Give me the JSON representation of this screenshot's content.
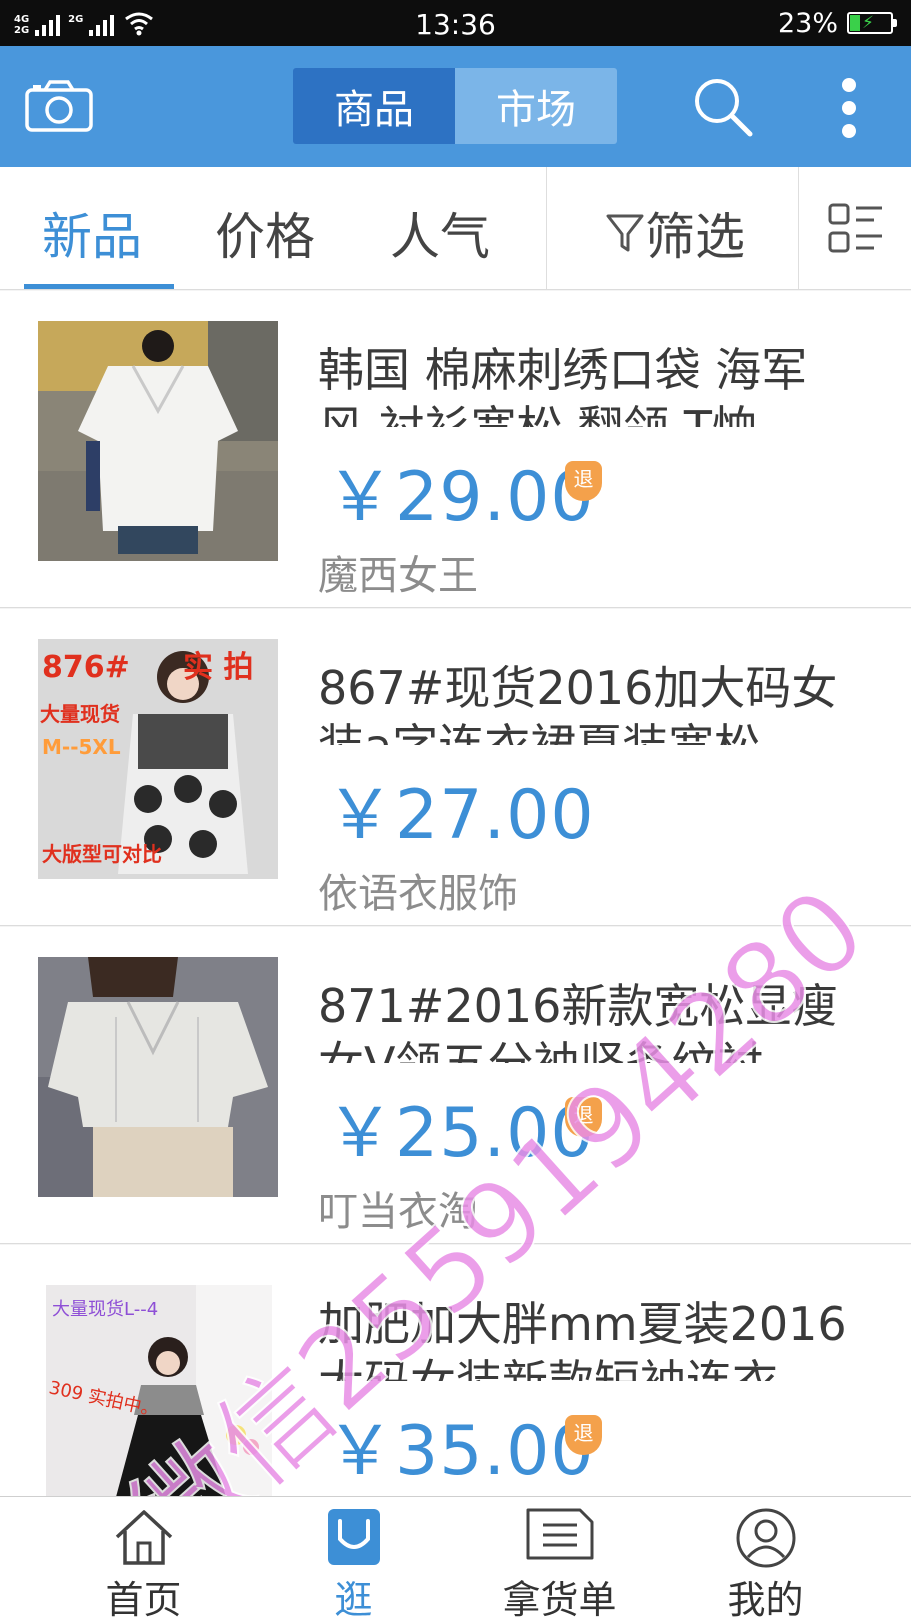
{
  "status_bar": {
    "network_top": "4G",
    "network_bottom": "2G",
    "network2": "2G",
    "time": "13:36",
    "battery": "23%"
  },
  "header": {
    "tabs": [
      {
        "label": "商品",
        "active": true
      },
      {
        "label": "市场",
        "active": false
      }
    ],
    "icons": [
      "camera-icon",
      "search-icon",
      "more-icon"
    ]
  },
  "sort_bar": {
    "tabs": [
      {
        "label": "新品",
        "active": true
      },
      {
        "label": "价格",
        "active": false
      },
      {
        "label": "人气",
        "active": false
      }
    ],
    "filter_label": "筛选"
  },
  "products": [
    {
      "title_line1": "韩国 棉麻刺绣口袋 海军",
      "title_line2": "风 衬衫宽松 翻领 T恤 …",
      "price": "￥29.00",
      "badge": "退",
      "shop": "魔西女王"
    },
    {
      "title_line1": "867#现货2016加大码女",
      "title_line2": "装a字连衣裙夏装宽松…",
      "price": "￥27.00",
      "badge": "",
      "shop": "依语衣服饰",
      "photo_text": {
        "code": "876#",
        "tag": "实 拍",
        "stock": "大量现货",
        "sizes": "M--5XL",
        "compare": "大版型可对比"
      }
    },
    {
      "title_line1": "871#2016新款宽松显瘦",
      "title_line2": "女V领五分袖竖条纹衬…",
      "price": "￥25.00",
      "badge": "退",
      "shop": "叮当衣淘"
    },
    {
      "title_line1": "加肥加大胖mm夏装2016",
      "title_line2": "大码女装新款短袖连衣…",
      "price": "￥35.00",
      "badge": "退",
      "shop": "",
      "photo_text": {
        "stock": "大量现货L--4",
        "tag": "309 实拍中。"
      }
    }
  ],
  "watermark": "微信2559194280",
  "bottom_nav": [
    {
      "label": "首页",
      "icon": "home-icon",
      "active": false
    },
    {
      "label": "逛",
      "icon": "browse-bag-icon",
      "active": true
    },
    {
      "label": "拿货单",
      "icon": "order-list-icon",
      "active": false
    },
    {
      "label": "我的",
      "icon": "profile-icon",
      "active": false
    }
  ],
  "colors": {
    "accent": "#3d8fd6",
    "header": "#4a97dc",
    "badge": "#f4a14b",
    "watermark": "#e88ee6"
  }
}
